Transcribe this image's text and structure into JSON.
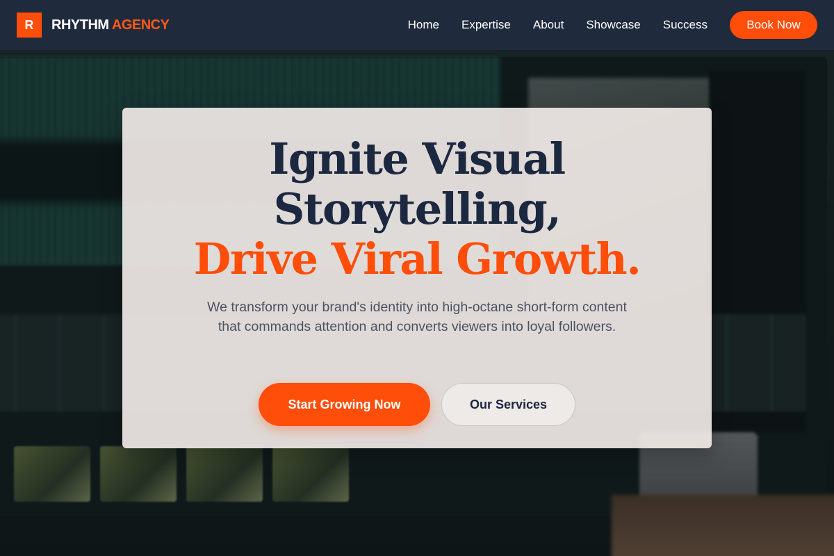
{
  "brand": {
    "mark": "R",
    "name_part1": "RHYTHM",
    "name_part2": "AGENCY",
    "accent_color": "#ff4d0a",
    "nav_bg": "#1f2a3d"
  },
  "nav": {
    "links": [
      "Home",
      "Expertise",
      "About",
      "Showcase",
      "Success"
    ],
    "cta": "Book Now"
  },
  "hero": {
    "headline_line1": "Ignite Visual",
    "headline_line2": "Storytelling,",
    "headline_line3": "Drive Viral Growth.",
    "subtext": "We transform your brand's identity into high-octane short-form content that commands attention and converts viewers into loyal followers.",
    "primary_button": "Start Growing Now",
    "secondary_button": "Our Services"
  }
}
